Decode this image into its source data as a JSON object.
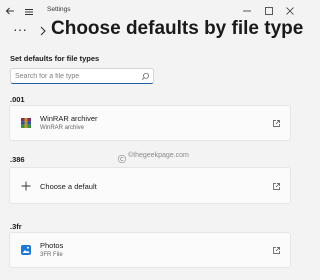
{
  "window": {
    "app_title": "Settings"
  },
  "header": {
    "page_title": "Choose defaults by file type",
    "more_label": "···"
  },
  "main": {
    "section_heading": "Set defaults for file types",
    "search": {
      "placeholder": "Search for a file type",
      "value": ""
    },
    "groups": [
      {
        "extension": ".001",
        "app_name": "WinRAR archiver",
        "app_sub": "WinRAR archive",
        "icon": "winrar-icon"
      },
      {
        "extension": ".386",
        "app_name": "Choose a default",
        "app_sub": "",
        "icon": "plus-icon"
      },
      {
        "extension": ".3fr",
        "app_name": "Photos",
        "app_sub": "3FR File",
        "icon": "photos-icon"
      }
    ]
  },
  "watermark": {
    "text": "©thegeekpage.com"
  },
  "colors": {
    "accent": "#1f5fa8",
    "background": "#f3f3f3",
    "card": "#fbfbfb"
  }
}
